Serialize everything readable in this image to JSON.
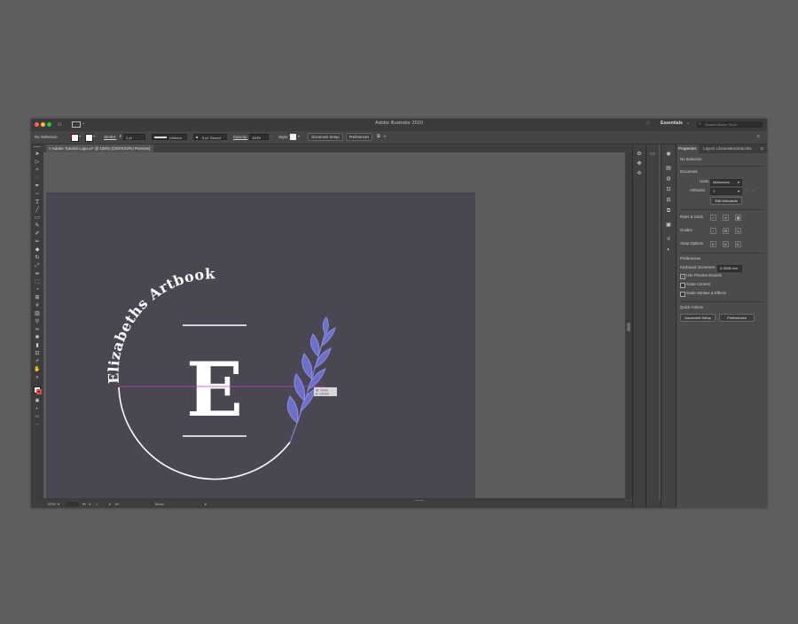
{
  "window": {
    "title": "Adobe Illustrator 2020",
    "workspace": "Essentials",
    "search_placeholder": "Search Adobe Stock"
  },
  "control_bar": {
    "selection_label": "No Selection",
    "stroke_label": "Stroke:",
    "stroke_value": "2 pt",
    "stroke_profile": "Uniform",
    "brush_value": "5 pt. Round",
    "opacity_label": "Opacity:",
    "opacity_value": "100%",
    "style_label": "Style:",
    "document_setup": "Document Setup",
    "preferences": "Preferences"
  },
  "document_tab": {
    "label": "Adobe Tutorial Logo.ai* @ 150% (CMYK/GPU Preview)",
    "close": "×"
  },
  "artwork": {
    "arc_text": "Elizabeths Artbook",
    "monogram": "E",
    "tooltip_line1": "W: -0 mm",
    "tooltip_line2": "H: 1.6 mm"
  },
  "status_bar": {
    "zoom": "150%",
    "artboard": "1",
    "tool": "Move"
  },
  "properties_panel": {
    "tabs": [
      "Properties",
      "Layers",
      "Libraries",
      "Actions",
      "Links"
    ],
    "selection": "No Selection",
    "document_heading": "Document",
    "units_label": "Units:",
    "units_value": "Millimeters",
    "artboard_label": "Artboard:",
    "artboard_value": "1",
    "edit_artboards": "Edit Artboards",
    "rulers_grids": "Ruler & Grids",
    "guides": "Guides",
    "snap_options": "Snap Options",
    "preferences_heading": "Preferences",
    "keyboard_increment_label": "Keyboard Increment:",
    "keyboard_increment_value": "0.3528 mm",
    "use_preview_bounds": "Use Preview Bounds",
    "scale_corners": "Scale Corners",
    "scale_strokes": "Scale Strokes & Effects",
    "quick_actions": "Quick Actions",
    "document_setup": "Document Setup",
    "preferences": "Preferences"
  },
  "colors": {
    "artboard": "#494752",
    "leaf_blue": "#8b8ee8",
    "guide_magenta": "#c23cc2",
    "close_red": "#ff5f56",
    "min_yellow": "#ffbd2e",
    "max_green": "#27c93f"
  },
  "icons": {
    "toolbar": [
      "selection-tool-icon",
      "direct-selection-tool-icon",
      "magic-wand-tool-icon",
      "lasso-tool-icon",
      "pen-tool-icon",
      "curvature-tool-icon",
      "type-tool-icon",
      "line-tool-icon",
      "rectangle-tool-icon",
      "paintbrush-tool-icon",
      "shaper-tool-icon",
      "pencil-tool-icon",
      "eraser-tool-icon",
      "rotate-tool-icon",
      "scale-tool-icon",
      "width-tool-icon",
      "free-transform-tool-icon",
      "shape-builder-tool-icon",
      "perspective-grid-tool-icon",
      "mesh-tool-icon",
      "gradient-tool-icon",
      "eyedropper-tool-icon",
      "blend-tool-icon",
      "symbol-sprayer-tool-icon",
      "column-graph-tool-icon",
      "artboard-tool-icon",
      "slice-tool-icon",
      "hand-tool-icon",
      "zoom-tool-icon"
    ]
  }
}
